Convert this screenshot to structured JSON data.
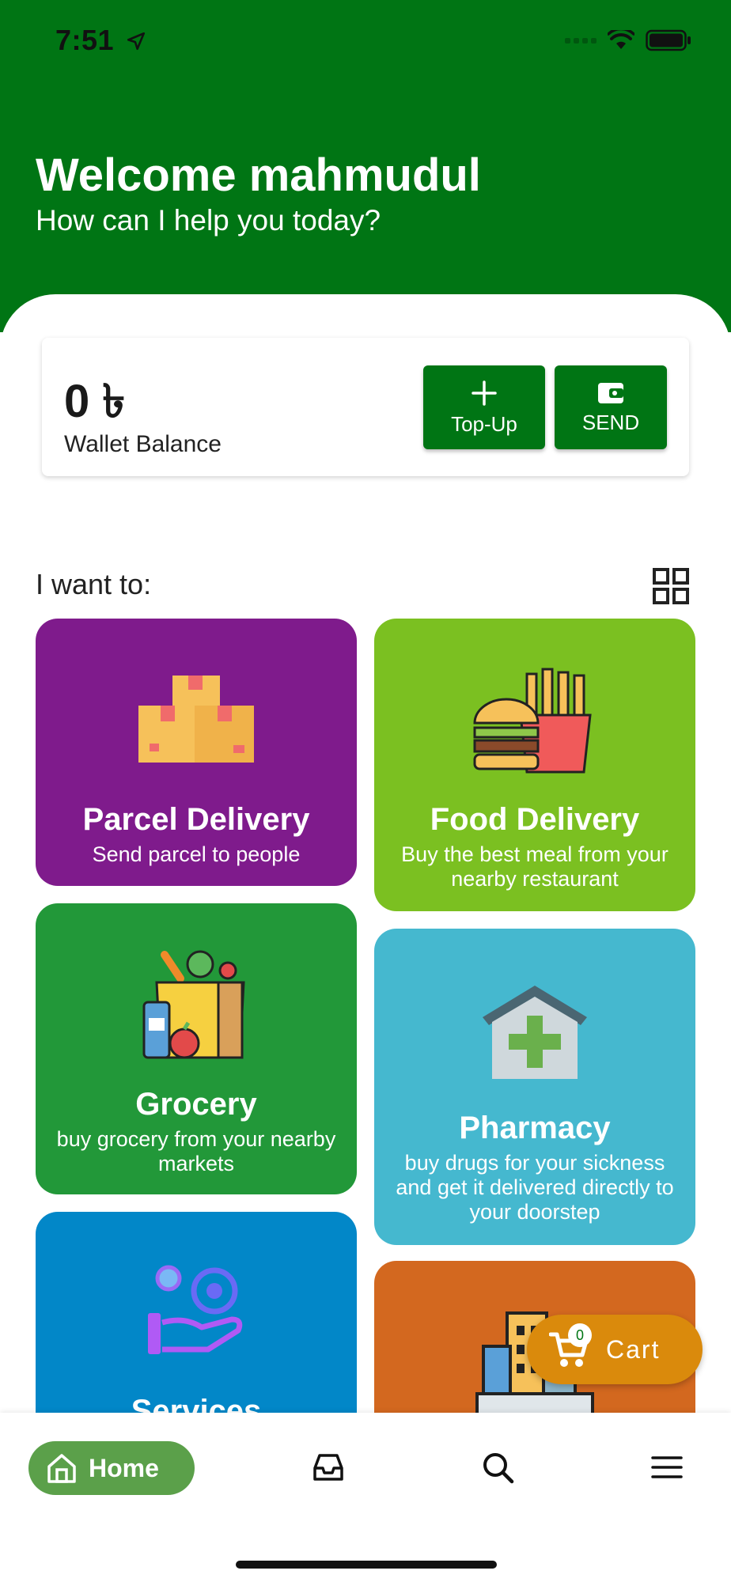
{
  "status_bar": {
    "time": "7:51"
  },
  "header": {
    "welcome": "Welcome mahmudul",
    "subtitle": "How can I help you today?",
    "background_color": "#007514"
  },
  "wallet": {
    "balance": "0 ৳",
    "label": "Wallet Balance",
    "topup_label": "Top-Up",
    "send_label": "SEND"
  },
  "services": {
    "section_label": "I want to:",
    "tiles": [
      {
        "title": "Parcel Delivery",
        "desc": "Send parcel to people",
        "color": "#7f1b8c",
        "icon": "boxes-icon"
      },
      {
        "title": "Food Delivery",
        "desc": "Buy the best meal from your nearby restaurant",
        "color": "#7bc021",
        "icon": "burger-fries-icon"
      },
      {
        "title": "Grocery",
        "desc": "buy grocery from your nearby markets",
        "color": "#229839",
        "icon": "grocery-bag-icon"
      },
      {
        "title": "Pharmacy",
        "desc": "buy drugs for your sickness and get it delivered directly to your doorstep",
        "color": "#45b8cf",
        "icon": "pharmacy-icon"
      },
      {
        "title": "Services",
        "desc": "",
        "color": "#0287c8",
        "icon": "service-hand-icon"
      },
      {
        "title": "",
        "desc": "",
        "color": "#d3681f",
        "icon": "building-icon"
      }
    ]
  },
  "cart": {
    "count": "0",
    "label": "Cart"
  },
  "bottom_nav": {
    "home_label": "Home"
  }
}
